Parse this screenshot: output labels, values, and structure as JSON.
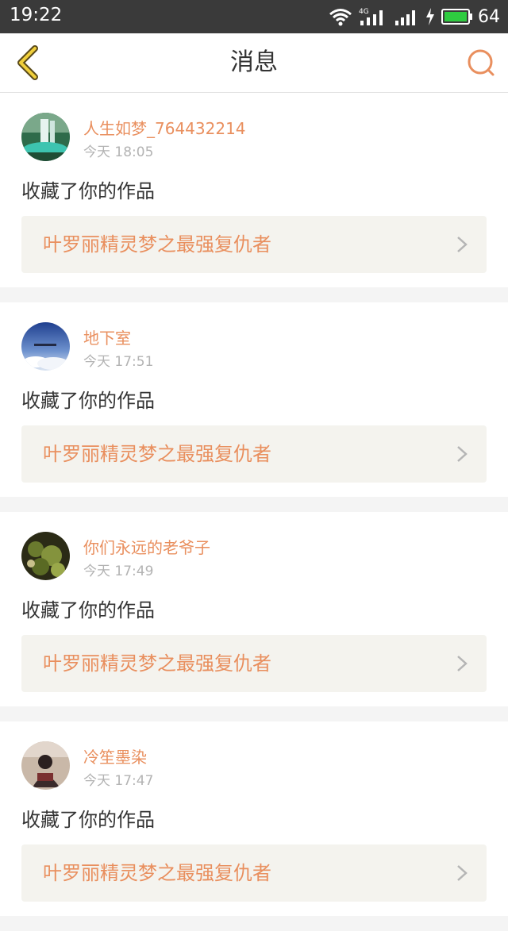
{
  "status_bar": {
    "time": "19:22",
    "network": "4G",
    "battery": "64",
    "battery_color": "#2ecc40"
  },
  "header": {
    "title": "消息",
    "accent_color": "#e98f5e",
    "back_icon": "chevron-left-icon",
    "search_icon": "search-icon"
  },
  "notifications": [
    {
      "username": "人生如梦_764432214",
      "time": "今天 18:05",
      "action": "收藏了你的作品",
      "work_title": "叶罗丽精灵梦之最强复仇者",
      "avatar": "waterfall"
    },
    {
      "username": "地下室",
      "time": "今天 17:51",
      "action": "收藏了你的作品",
      "work_title": "叶罗丽精灵梦之最强复仇者",
      "avatar": "sky"
    },
    {
      "username": "你们永远的老爷子",
      "time": "今天 17:49",
      "action": "收藏了你的作品",
      "work_title": "叶罗丽精灵梦之最强复仇者",
      "avatar": "plants"
    },
    {
      "username": "冷笙墨染",
      "time": "今天 17:47",
      "action": "收藏了你的作品",
      "work_title": "叶罗丽精灵梦之最强复仇者",
      "avatar": "person"
    }
  ]
}
